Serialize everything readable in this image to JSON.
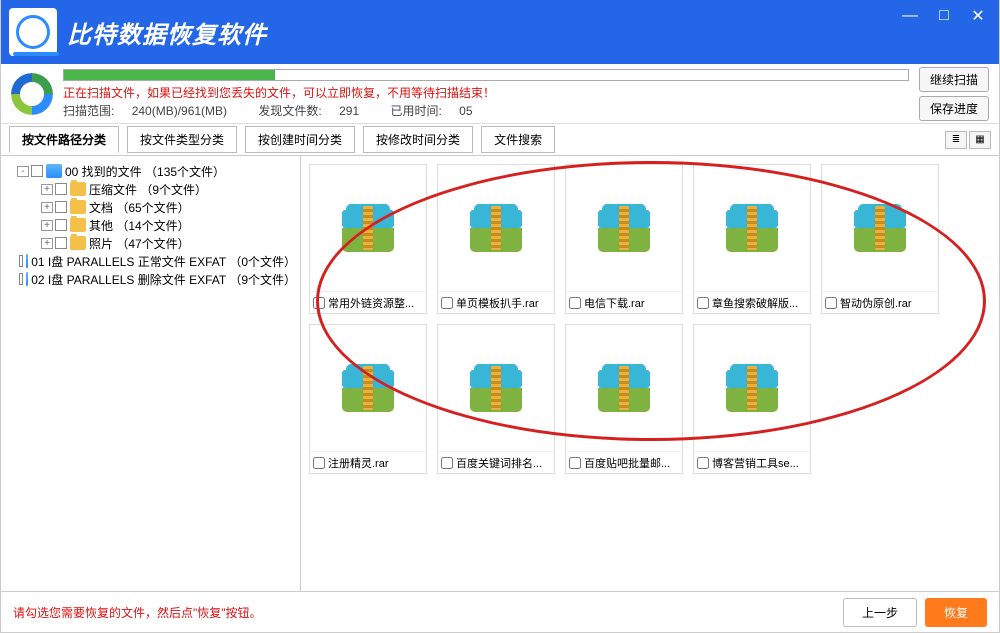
{
  "app": {
    "title": "比特数据恢复软件"
  },
  "window_controls": {
    "minimize": "—",
    "maximize": "□",
    "close": "✕"
  },
  "status": {
    "message": "正在扫描文件，如果已经找到您丢失的文件，可以立即恢复，不用等待扫描结束！",
    "scan_range_label": "扫描范围:",
    "scan_range_value": "240(MB)/961(MB)",
    "found_label": "发现文件数:",
    "found_value": "291",
    "elapsed_label": "已用时间:",
    "elapsed_value": "05",
    "progress_percent": 25,
    "btn_continue": "继续扫描",
    "btn_save": "保存进度"
  },
  "tabs": {
    "items": [
      "按文件路径分类",
      "按文件类型分类",
      "按创建时间分类",
      "按修改时间分类",
      "文件搜索"
    ],
    "active": 0
  },
  "tree": {
    "root0": "00 找到的文件 （135个文件）",
    "child0": "压缩文件   （9个文件）",
    "child1": "文档   （65个文件）",
    "child2": "其他   （14个文件）",
    "child3": "照片   （47个文件）",
    "root1": "01 I盘 PARALLELS 正常文件 EXFAT （0个文件）",
    "root2": "02 I盘 PARALLELS 删除文件 EXFAT （9个文件）"
  },
  "files": [
    {
      "name": "常用外链资源整..."
    },
    {
      "name": "单页模板扒手.rar"
    },
    {
      "name": "电信下载.rar"
    },
    {
      "name": "章鱼搜索破解版..."
    },
    {
      "name": "智动伪原创.rar"
    },
    {
      "name": "注册精灵.rar"
    },
    {
      "name": "百度关键词排名..."
    },
    {
      "name": "百度贴吧批量邮..."
    },
    {
      "name": "博客营销工具se..."
    }
  ],
  "footer": {
    "hint": "请勾选您需要恢复的文件，然后点\"恢复\"按钮。",
    "prev": "上一步",
    "recover": "恢复"
  }
}
